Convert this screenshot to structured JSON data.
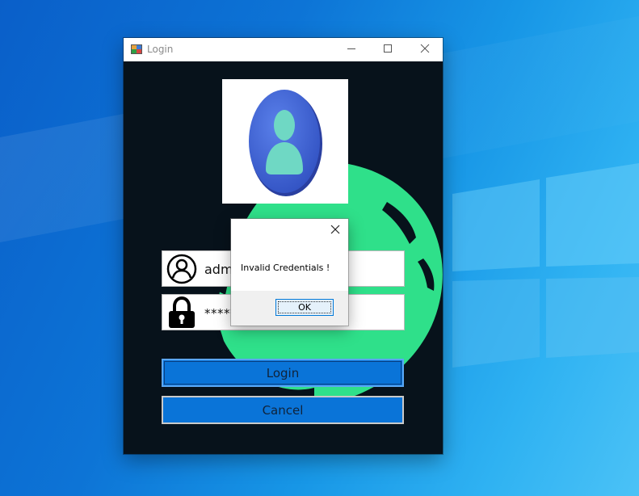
{
  "window": {
    "title": "Login",
    "icons": {
      "app": "app-form-icon",
      "minimize": "minimize-icon",
      "maximize": "maximize-icon",
      "close": "close-icon"
    }
  },
  "form": {
    "username": {
      "icon": "user-icon",
      "value": "admi"
    },
    "password": {
      "icon": "lock-icon",
      "value": "*****"
    },
    "login_label": "Login",
    "cancel_label": "Cancel"
  },
  "message_box": {
    "text": "Invalid Credentials !",
    "ok_label": "OK",
    "close_icon": "close-icon"
  },
  "colors": {
    "form_background": "#07121b",
    "globe_green": "#2fe08a",
    "button_blue": "#0a74d8",
    "avatar_blue": "#3f63d4",
    "avatar_figure": "#6fd8c4"
  }
}
